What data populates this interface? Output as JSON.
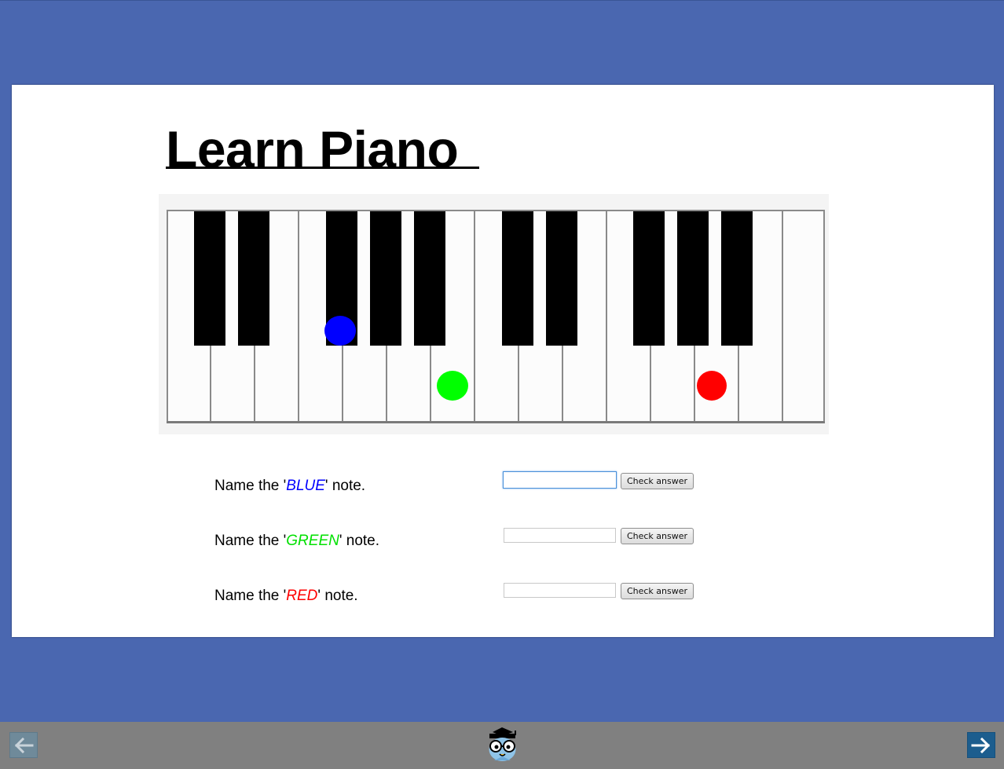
{
  "page": {
    "title": "Learn Piano",
    "background_color": "#4a67b0",
    "slide_color": "#ffffff"
  },
  "keyboard": {
    "white_key_count": 15,
    "black_keys": [
      "C#",
      "D#",
      "F#",
      "G#",
      "A#",
      "C#",
      "D#",
      "F#",
      "G#",
      "A#"
    ],
    "markers": [
      {
        "color_name": "BLUE",
        "color": "#0000ff"
      },
      {
        "color_name": "GREEN",
        "color": "#00ff00"
      },
      {
        "color_name": "RED",
        "color": "#ff0000"
      }
    ]
  },
  "questions": [
    {
      "prefix": "Name the '",
      "note_name": "BLUE",
      "suffix": "' note.",
      "color": "#0000ff",
      "input_value": "",
      "button_label": "Check answer"
    },
    {
      "prefix": "Name the '",
      "note_name": "GREEN",
      "suffix": "' note.",
      "color": "#00ff00",
      "input_value": "",
      "button_label": "Check answer"
    },
    {
      "prefix": "Name the '",
      "note_name": "RED",
      "suffix": "' note.",
      "color": "#ff0000",
      "input_value": "",
      "button_label": "Check answer"
    }
  ],
  "navigation": {
    "prev_icon": "arrow-left-icon",
    "next_icon": "arrow-right-icon",
    "logo_icon": "owl-graduate-icon"
  }
}
